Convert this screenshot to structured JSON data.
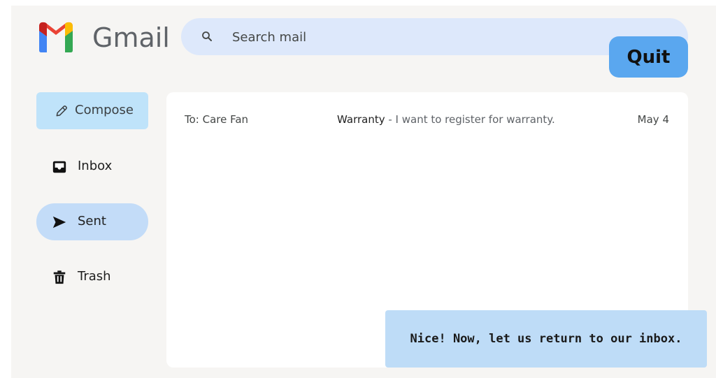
{
  "header": {
    "brand": "Gmail",
    "search_placeholder": "Search mail",
    "search_icon": "search-icon",
    "quit_label": "Quit",
    "logo_icon": "gmail-logo-icon"
  },
  "sidebar": {
    "items": [
      {
        "label": "Compose",
        "icon": "pencil-icon"
      },
      {
        "label": "Inbox",
        "icon": "inbox-icon"
      },
      {
        "label": "Sent",
        "icon": "send-icon",
        "active": true
      },
      {
        "label": "Trash",
        "icon": "trash-icon"
      }
    ]
  },
  "mail_list": {
    "rows": [
      {
        "to": "To: Care Fan",
        "subject": "Warranty",
        "separator": " - ",
        "snippet": "I want to register for warranty.",
        "date": "May 4"
      }
    ]
  },
  "tooltip": {
    "text": "Nice! Now, let us return to our inbox."
  },
  "colors": {
    "background": "#f6f5f3",
    "search_bg": "#dde8fb",
    "quit_bg": "#5aa7ef",
    "compose_bg": "#bfe3fa",
    "sent_active_bg": "#c3dcf8",
    "tooltip_bg": "#bedcf7",
    "gmail_red": "#ea4335",
    "gmail_blue": "#4285f4",
    "gmail_green": "#34a853",
    "gmail_yellow": "#fbbc04"
  }
}
